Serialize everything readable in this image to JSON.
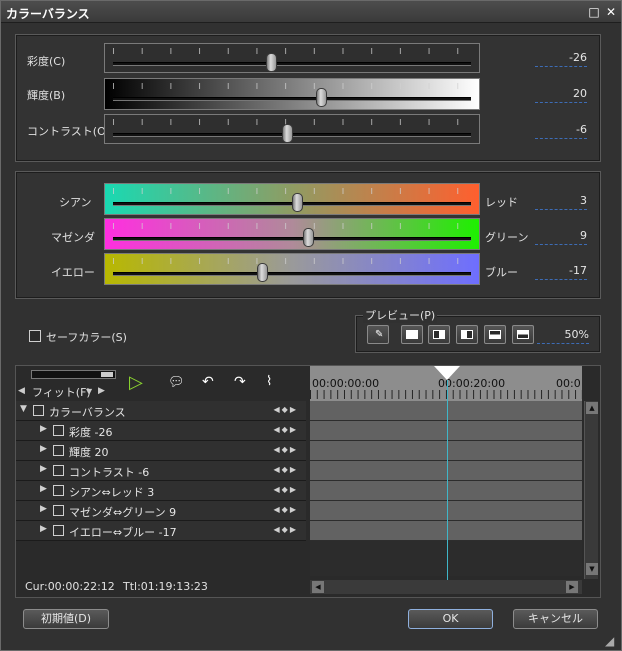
{
  "window": {
    "title": "カラーバランス",
    "btn_restore": "□",
    "btn_close": "✕"
  },
  "basic": {
    "saturation": {
      "label": "彩度(C)",
      "value": "-26",
      "level": 0.44
    },
    "brightness": {
      "label": "輝度(B)",
      "value": "20",
      "level": 0.58
    },
    "contrast": {
      "label": "コントラスト(O)",
      "value": "-6",
      "level": 0.485
    }
  },
  "rgb": {
    "cyan_red": {
      "left": "シアン",
      "right": "レッド",
      "value": "3",
      "level": 0.515
    },
    "magenta_green": {
      "left": "マゼンダ",
      "right": "グリーン",
      "value": "9",
      "level": 0.545
    },
    "yellow_blue": {
      "left": "イエロー",
      "right": "ブルー",
      "value": "-17",
      "level": 0.415
    }
  },
  "safe_color": {
    "label": "セーフカラー(S)"
  },
  "preview": {
    "label": "プレビュー(P)",
    "zoom": "50%"
  },
  "timeline": {
    "fit_label": "フィット(F)",
    "time_start": "00:00:00:00",
    "time_mid": "00:00:20:00",
    "time_end": "00:0",
    "cur": "Cur:00:00:22:12",
    "ttl": "Ttl:01:19:13:23",
    "tracks": [
      {
        "label": "カラーバランス"
      },
      {
        "label": "彩度  -26"
      },
      {
        "label": "輝度  20"
      },
      {
        "label": "コントラスト  -6"
      },
      {
        "label": "シアン⇔レッド  3"
      },
      {
        "label": "マゼンダ⇔グリーン  9"
      },
      {
        "label": "イエロー⇔ブルー  -17"
      }
    ]
  },
  "footer": {
    "reset": "初期値(D)",
    "ok": "OK",
    "cancel": "キャンセル"
  },
  "colors": {
    "accent_line": "#3d6cb5",
    "playhead": "#3fb6c8"
  }
}
